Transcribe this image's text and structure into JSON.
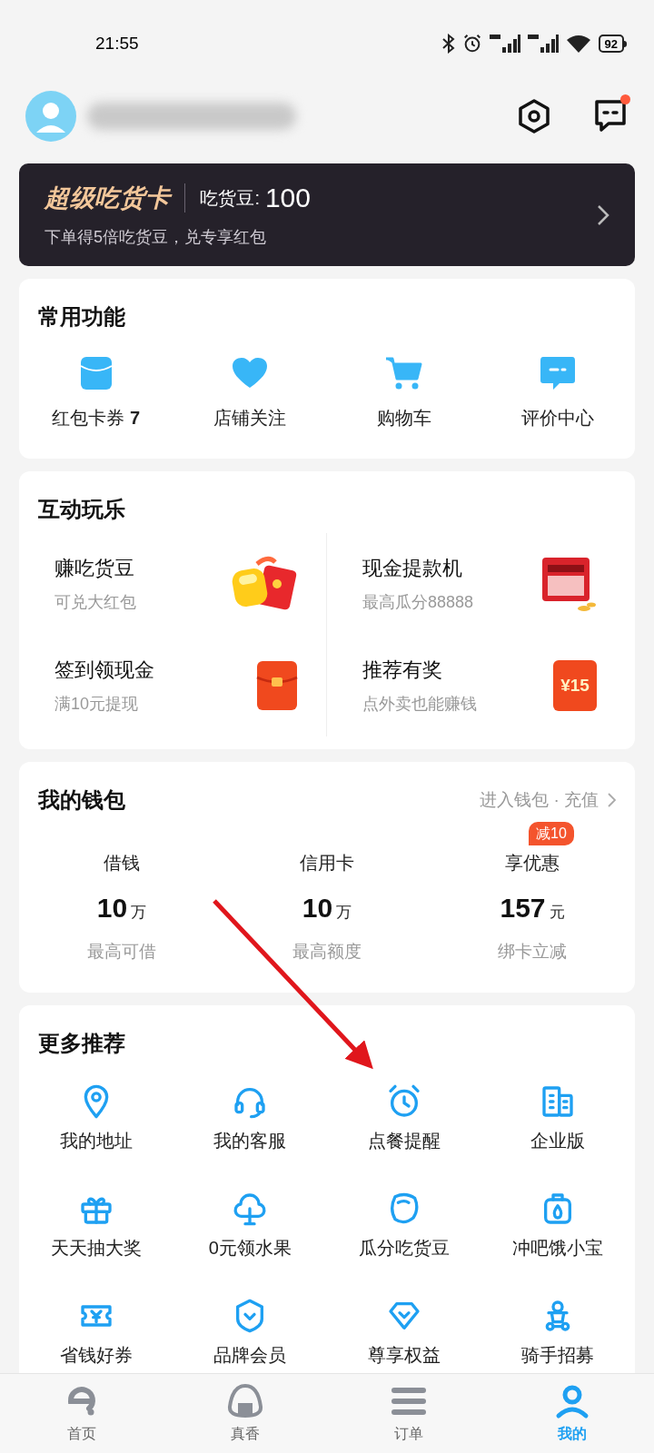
{
  "status_bar": {
    "time": "21:55",
    "battery": "92"
  },
  "header": {
    "has_message_dot": true
  },
  "super_card": {
    "title": "超级吃货卡",
    "beans_label": "吃货豆:",
    "beans_value": "100",
    "subtitle": "下单得5倍吃货豆，兑专享红包"
  },
  "common": {
    "title": "常用功能",
    "items": [
      {
        "label": "红包卡券",
        "badge": "7"
      },
      {
        "label": "店铺关注"
      },
      {
        "label": "购物车"
      },
      {
        "label": "评价中心"
      }
    ]
  },
  "fun": {
    "title": "互动玩乐",
    "items": [
      {
        "title": "赚吃货豆",
        "subtitle": "可兑大红包"
      },
      {
        "title": "现金提款机",
        "subtitle": "最高瓜分88888"
      },
      {
        "title": "签到领现金",
        "subtitle": "满10元提现"
      },
      {
        "title": "推荐有奖",
        "subtitle": "点外卖也能赚钱",
        "icon_text": "¥15"
      }
    ]
  },
  "wallet": {
    "title": "我的钱包",
    "link": "进入钱包 · 充值",
    "items": [
      {
        "label": "借钱",
        "value": "10",
        "unit": "万",
        "caption": "最高可借"
      },
      {
        "label": "信用卡",
        "value": "10",
        "unit": "万",
        "caption": "最高额度"
      },
      {
        "label": "享优惠",
        "value": "157",
        "unit": "元",
        "caption": "绑卡立减",
        "tag": "减10"
      }
    ]
  },
  "more": {
    "title": "更多推荐",
    "items": [
      {
        "label": "我的地址"
      },
      {
        "label": "我的客服"
      },
      {
        "label": "点餐提醒"
      },
      {
        "label": "企业版"
      },
      {
        "label": "天天抽大奖"
      },
      {
        "label": "0元领水果"
      },
      {
        "label": "瓜分吃货豆"
      },
      {
        "label": "冲吧饿小宝"
      },
      {
        "label": "省钱好券"
      },
      {
        "label": "品牌会员"
      },
      {
        "label": "尊享权益"
      },
      {
        "label": "骑手招募"
      }
    ]
  },
  "tab_bar": {
    "items": [
      {
        "label": "首页",
        "selected": false
      },
      {
        "label": "真香",
        "selected": false
      },
      {
        "label": "订单",
        "selected": false
      },
      {
        "label": "我的",
        "selected": true
      }
    ]
  }
}
